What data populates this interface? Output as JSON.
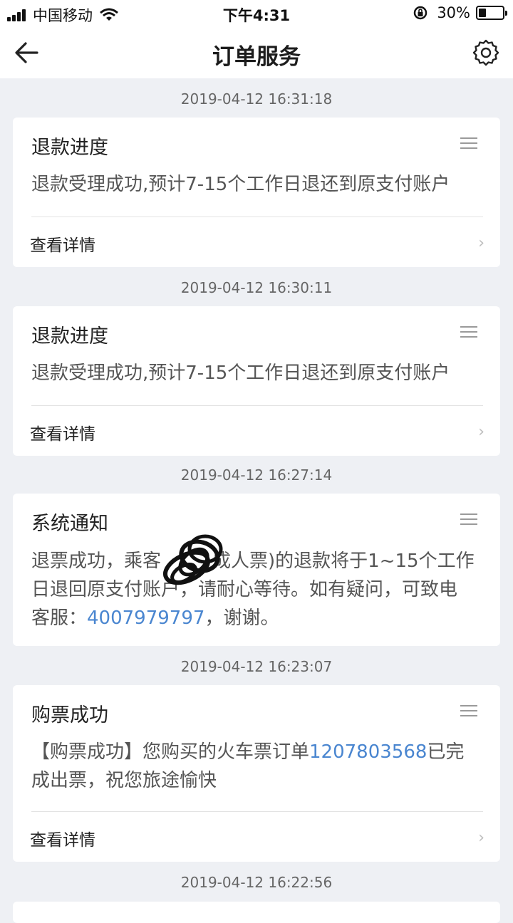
{
  "status_bar": {
    "carrier": "中国移动",
    "time": "下午4:31",
    "battery_pct": "30%"
  },
  "header": {
    "title": "订单服务",
    "back_icon": "back-arrow-icon",
    "settings_icon": "gear-icon"
  },
  "messages": [
    {
      "timestamp": "2019-04-12 16:31:18",
      "title": "退款进度",
      "body": "退款受理成功,预计7-15个工作日退还到原支付账户",
      "details_label": "查看详情"
    },
    {
      "timestamp": "2019-04-12 16:30:11",
      "title": "退款进度",
      "body": "退款受理成功,预计7-15个工作日退还到原支付账户",
      "details_label": "查看详情"
    },
    {
      "timestamp": "2019-04-12 16:27:14",
      "title": "系统通知",
      "body_line1": "退票成功，乘客",
      "body_line1_b": "成人票)的退款将于1~15个工作",
      "body_line2": "日退回原支付账户，请耐心等待。如有疑问，可致电",
      "body_line3_pre": "客服：",
      "phone": "4007979797",
      "body_line3_post": "，谢谢。"
    },
    {
      "timestamp": "2019-04-12 16:23:07",
      "title": "购票成功",
      "body_pre": "【购票成功】您购买的火车票订单",
      "order_no": "1207803568",
      "body_post": "已完",
      "body_line2": "成出票，祝您旅途愉快",
      "details_label": "查看详情"
    }
  ],
  "next_timestamp": "2019-04-12 16:22:56"
}
